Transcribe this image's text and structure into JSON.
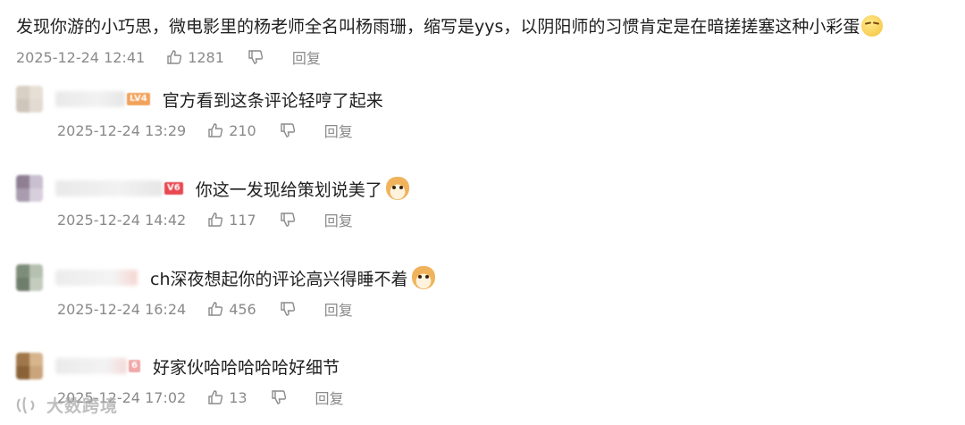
{
  "main_comment": {
    "text": "发现你游的小巧思，微电影里的杨老师全名叫杨雨珊，缩写是yys，以阴阳师的习惯肯定是在暗搓搓塞这种小彩蛋",
    "emoji": "smirk-face",
    "time": "2025-12-24 12:41",
    "likes": "1281",
    "reply_label": "回复"
  },
  "replies": [
    {
      "text": "官方看到这条评论轻哼了起来",
      "badge": "LV4",
      "emoji": "",
      "time": "2025-12-24 13:29",
      "likes": "210",
      "reply_label": "回复"
    },
    {
      "text": "你这一发现给策划说美了",
      "badge": "V6",
      "emoji": "doge",
      "time": "2025-12-24 14:42",
      "likes": "117",
      "reply_label": "回复"
    },
    {
      "text": "ch深夜想起你的评论高兴得睡不着",
      "badge": "",
      "emoji": "doge",
      "time": "2025-12-24 16:24",
      "likes": "456",
      "reply_label": "回复"
    },
    {
      "text": "好家伙哈哈哈哈哈好细节",
      "badge": "6",
      "emoji": "",
      "time": "2025-12-24 17:02",
      "likes": "13",
      "reply_label": "回复"
    }
  ],
  "watermark": {
    "text": "大数跨境"
  },
  "colors": {
    "meta": "#8a8a8a",
    "text": "#1f1f1f",
    "badge_lv": "#f2a25a",
    "badge_v": "#e8474f"
  }
}
